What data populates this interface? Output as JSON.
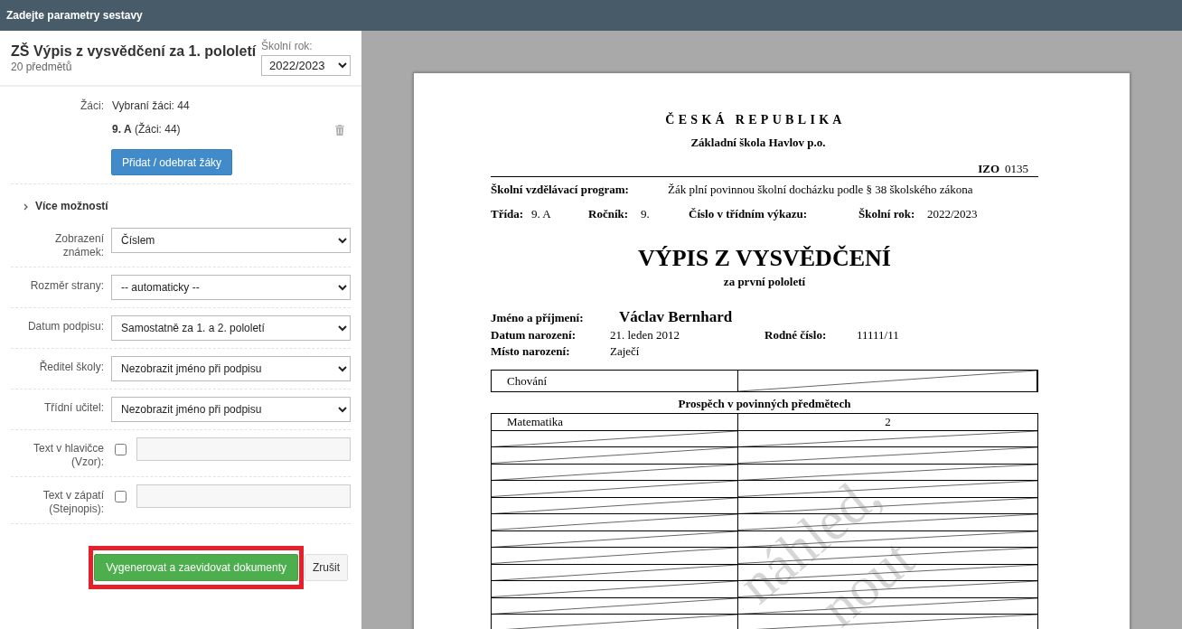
{
  "window": {
    "title": "Zadejte parametry sestavy"
  },
  "report": {
    "title": "ZŠ Výpis z vysvědčení za 1. pololetí",
    "subtitle": "20 předmětů",
    "year_label": "Školní rok:",
    "year": "2022/2023"
  },
  "students": {
    "label": "Žáci:",
    "summary": "Vybraní žáci: 44",
    "groups": [
      {
        "text": "**9. A** (Žáci: 44)"
      }
    ],
    "button": "Přidat / odebrat žáky"
  },
  "more_options": {
    "label": "Více možností"
  },
  "options": [
    {
      "kind": "select",
      "label": "Zobrazení známek:",
      "value": "Číslem"
    },
    {
      "kind": "select",
      "label": "Rozměr strany:",
      "value": "-- automaticky --"
    },
    {
      "kind": "select",
      "label": "Datum podpisu:",
      "value": "Samostatně za 1. a 2. pololetí"
    },
    {
      "kind": "select",
      "label": "Ředitel školy:",
      "value": "Nezobrazit jméno při podpisu"
    },
    {
      "kind": "select",
      "label": "Třídní učitel:",
      "value": "Nezobrazit jméno při podpisu"
    },
    {
      "kind": "checkbox_text",
      "label": "Text v hlavičce (Vzor):",
      "checked": false
    },
    {
      "kind": "checkbox_text",
      "label": "Text v zápatí (Stejnopis):",
      "checked": false
    }
  ],
  "buttons": [
    {
      "kind": "primary",
      "label": "Vygenerovat a zaevidovat dokumenty",
      "highlighted": true
    },
    {
      "kind": "default",
      "label": "Zrušit",
      "highlighted": false
    }
  ],
  "document": {
    "country": "ČESKÁ REPUBLIKA",
    "school": "Základní škola Havlov p.o.",
    "izo_label": "IZO",
    "izo": "0135",
    "program": {
      "label": "Školní vzdělávací program:",
      "value": "Žák plní povinnou školní docházku podle § 38 školského zákona"
    },
    "class_info": [
      {
        "label": "Třída:",
        "value": "9. A"
      },
      {
        "label": "Ročník:",
        "value": "9."
      },
      {
        "label": "Číslo v třídním výkazu:"
      },
      {
        "label": "Školní rok:",
        "value": "2022/2023"
      }
    ],
    "title": "VÝPIS Z VYSVĚDČENÍ",
    "period": "za první pololetí",
    "student": {
      "name_label": "Jméno a příjmení:",
      "name": "Václav Bernhard",
      "fields": [
        [
          {
            "label": "Datum narození:",
            "value": "21. leden 2012"
          },
          {
            "label": "Rodné číslo:",
            "value": "11111/11"
          }
        ],
        [
          {
            "label": "Místo narození:",
            "value": "Zaječí"
          }
        ]
      ]
    },
    "behavior": {
      "label": "Chování",
      "struck": true
    },
    "section_title": "Prospěch v povinných předmětech",
    "subjects": [
      {
        "kind": "graded",
        "subject": "Matematika",
        "grade": "2"
      },
      {
        "kind": "struck"
      },
      {
        "kind": "struck"
      },
      {
        "kind": "struck"
      },
      {
        "kind": "struck"
      },
      {
        "kind": "struck"
      },
      {
        "kind": "struck"
      },
      {
        "kind": "struck"
      },
      {
        "kind": "struck"
      },
      {
        "kind": "struck"
      },
      {
        "kind": "struck"
      },
      {
        "kind": "struck"
      },
      {
        "kind": "struck"
      }
    ],
    "watermark": [
      "náhled,",
      "nout"
    ]
  }
}
